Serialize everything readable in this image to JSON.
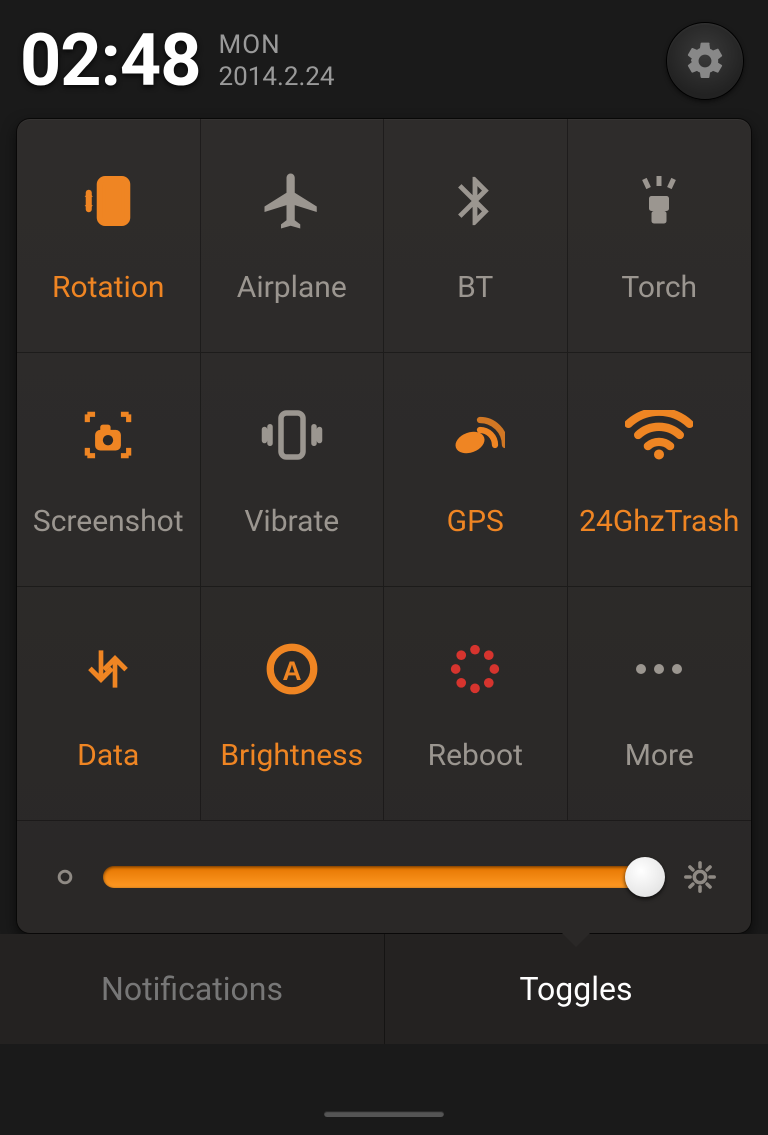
{
  "header": {
    "time": "02:48",
    "day": "MON",
    "date": "2014.2.24"
  },
  "tiles": [
    {
      "label": "Rotation",
      "color": "c-orange"
    },
    {
      "label": "Airplane",
      "color": "c-gray"
    },
    {
      "label": "BT",
      "color": "c-gray"
    },
    {
      "label": "Torch",
      "color": "c-gray"
    },
    {
      "label": "Screenshot",
      "color": "c-gray"
    },
    {
      "label": "Vibrate",
      "color": "c-gray"
    },
    {
      "label": "GPS",
      "color": "c-orange"
    },
    {
      "label": "24GhzTrash",
      "color": "c-orange"
    },
    {
      "label": "Data",
      "color": "c-orange"
    },
    {
      "label": "Brightness",
      "color": "c-orange"
    },
    {
      "label": "Reboot",
      "color": "c-gray"
    },
    {
      "label": "More",
      "color": "c-gray"
    }
  ],
  "brightness": {
    "value": 100
  },
  "tabs": {
    "notifications": "Notifications",
    "toggles": "Toggles",
    "active": "toggles"
  },
  "colors": {
    "accent": "#ef8523",
    "muted": "#9b9690",
    "red": "#d6342e"
  }
}
